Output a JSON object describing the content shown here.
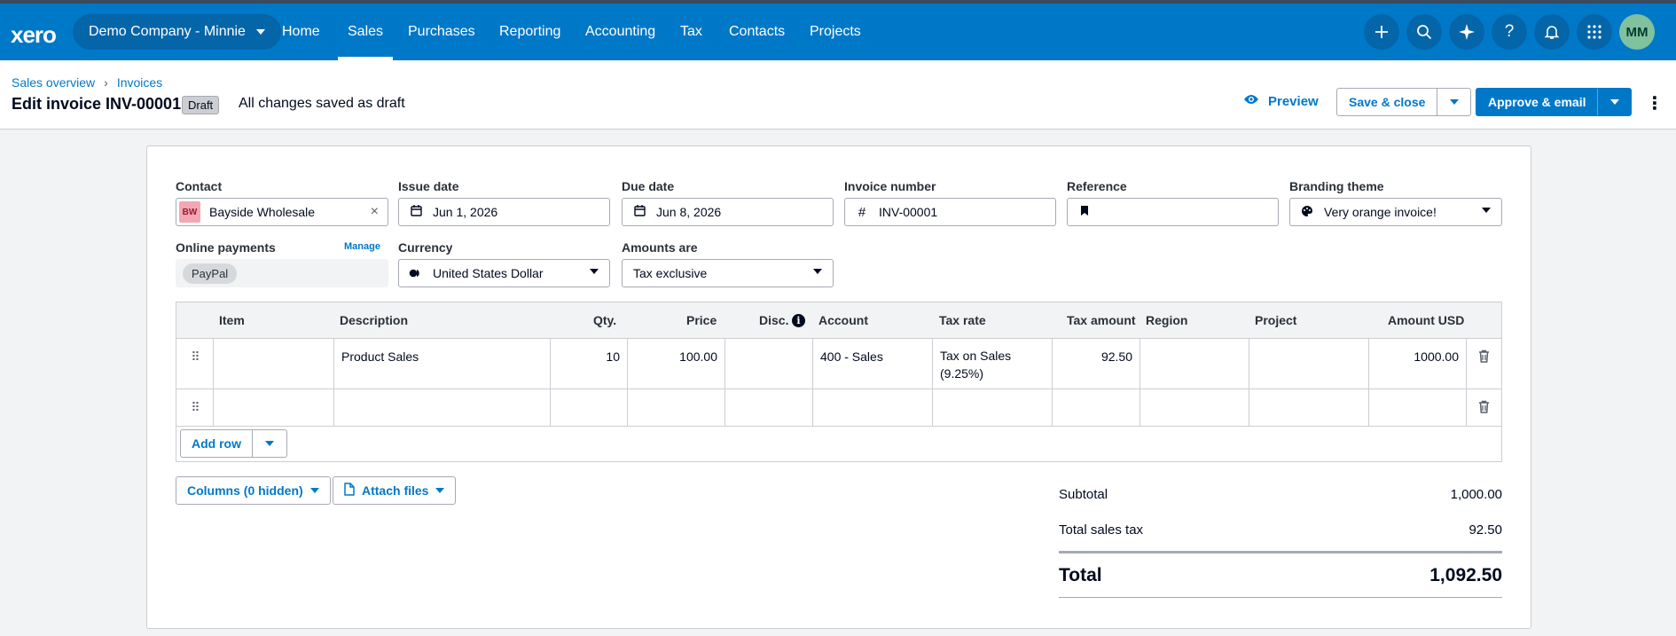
{
  "topbar": {
    "logo": "xero",
    "org_name": "Demo Company - Minnie",
    "nav": [
      {
        "label": "Home"
      },
      {
        "label": "Sales",
        "active": true
      },
      {
        "label": "Purchases"
      },
      {
        "label": "Reporting"
      },
      {
        "label": "Accounting"
      },
      {
        "label": "Tax"
      },
      {
        "label": "Contacts"
      },
      {
        "label": "Projects"
      }
    ],
    "icons": [
      "plus-icon",
      "search-icon",
      "sparkle-icon",
      "help-icon",
      "bell-icon",
      "apps-grid-icon"
    ],
    "avatar_initials": "MM"
  },
  "header": {
    "breadcrumb": [
      "Sales overview",
      "Invoices"
    ],
    "title": "Edit invoice INV-00001",
    "status_badge": "Draft",
    "save_status": "All changes saved as draft",
    "preview_label": "Preview",
    "save_close_label": "Save & close",
    "approve_label": "Approve & email"
  },
  "form": {
    "contact": {
      "label": "Contact",
      "initials": "BW",
      "value": "Bayside Wholesale"
    },
    "issue_date": {
      "label": "Issue date",
      "value": "Jun 1, 2026"
    },
    "due_date": {
      "label": "Due date",
      "value": "Jun 8, 2026"
    },
    "invoice_number": {
      "label": "Invoice number",
      "value": "INV-00001"
    },
    "reference": {
      "label": "Reference",
      "value": ""
    },
    "branding_theme": {
      "label": "Branding theme",
      "value": "Very orange invoice!"
    },
    "online_payments": {
      "label": "Online payments",
      "manage_label": "Manage",
      "method": "PayPal"
    },
    "currency": {
      "label": "Currency",
      "value": "United States Dollar"
    },
    "amounts_are": {
      "label": "Amounts are",
      "value": "Tax exclusive"
    }
  },
  "table": {
    "columns": {
      "item": "Item",
      "description": "Description",
      "qty": "Qty.",
      "price": "Price",
      "disc": "Disc.",
      "account": "Account",
      "tax_rate": "Tax rate",
      "tax_amount": "Tax amount",
      "region": "Region",
      "project": "Project",
      "amount": "Amount USD"
    },
    "rows": [
      {
        "item": "",
        "description": "Product Sales",
        "qty": "10",
        "price": "100.00",
        "disc": "",
        "account": "400 - Sales",
        "tax_rate_line1": "Tax on Sales",
        "tax_rate_line2": "(9.25%)",
        "tax_amount": "92.50",
        "region": "",
        "project": "",
        "amount": "1000.00"
      }
    ],
    "add_row_label": "Add row"
  },
  "lower": {
    "columns_label": "Columns (0 hidden)",
    "attach_label": "Attach files"
  },
  "totals": {
    "subtotal_label": "Subtotal",
    "subtotal": "1,000.00",
    "tax_label": "Total sales tax",
    "tax": "92.50",
    "total_label": "Total",
    "total": "1,092.50"
  }
}
